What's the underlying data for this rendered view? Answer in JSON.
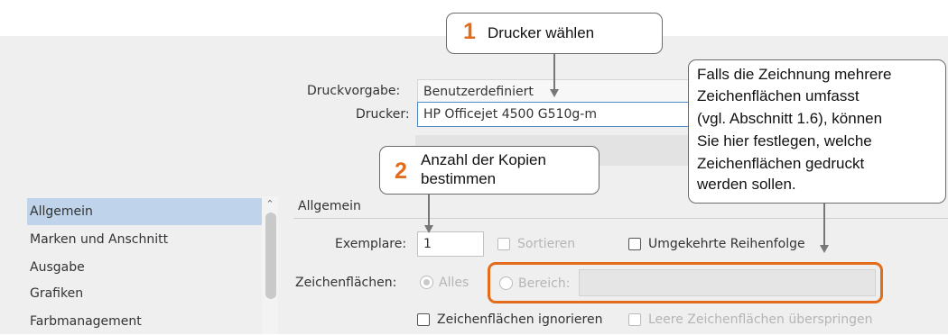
{
  "callouts": {
    "c1": {
      "number": "1",
      "text": "Drucker wählen"
    },
    "c2": {
      "number": "2",
      "line1": "Anzahl der Kopien",
      "line2": "bestimmen"
    },
    "c3": {
      "lines": [
        "Falls die Zeichnung mehrere",
        "Zeichenflächen umfasst",
        "(vgl. Abschnitt 1.6), können",
        "Sie hier festlegen, welche",
        "Zeichenflächen gedruckt",
        "werden sollen."
      ]
    }
  },
  "form": {
    "preset_label": "Druckvorgabe:",
    "preset_value": "Benutzerdefiniert",
    "printer_label": "Drucker:",
    "printer_value": "HP Officejet 4500 G510g-m"
  },
  "sidebar": {
    "items": [
      {
        "label": "Allgemein",
        "selected": true
      },
      {
        "label": "Marken und Anschnitt"
      },
      {
        "label": "Ausgabe"
      },
      {
        "label": "Grafiken"
      },
      {
        "label": "Farbmanagement"
      }
    ]
  },
  "section": {
    "title": "Allgemein",
    "copies_label": "Exemplare:",
    "copies_value": "1",
    "collate_label": "Sortieren",
    "reverse_label": "Umgekehrte Reihenfolge",
    "artboards_label": "Zeichenflächen:",
    "all_label": "Alles",
    "range_label": "Bereich:",
    "ignore_label": "Zeichenflächen ignorieren",
    "skip_label": "Leere Zeichenflächen überspringen"
  },
  "colors": {
    "accent": "#e36c1c",
    "selection": "#bfd3ea",
    "focus_border": "#4d88c7"
  }
}
